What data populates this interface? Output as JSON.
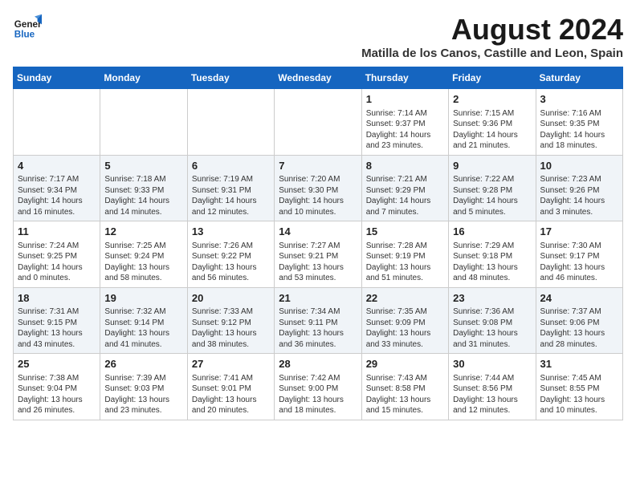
{
  "header": {
    "logo_line1": "General",
    "logo_line2": "Blue",
    "main_title": "August 2024",
    "subtitle": "Matilla de los Canos, Castille and Leon, Spain"
  },
  "calendar": {
    "days_of_week": [
      "Sunday",
      "Monday",
      "Tuesday",
      "Wednesday",
      "Thursday",
      "Friday",
      "Saturday"
    ],
    "weeks": [
      [
        {
          "day": "",
          "info": ""
        },
        {
          "day": "",
          "info": ""
        },
        {
          "day": "",
          "info": ""
        },
        {
          "day": "",
          "info": ""
        },
        {
          "day": "1",
          "info": "Sunrise: 7:14 AM\nSunset: 9:37 PM\nDaylight: 14 hours\nand 23 minutes."
        },
        {
          "day": "2",
          "info": "Sunrise: 7:15 AM\nSunset: 9:36 PM\nDaylight: 14 hours\nand 21 minutes."
        },
        {
          "day": "3",
          "info": "Sunrise: 7:16 AM\nSunset: 9:35 PM\nDaylight: 14 hours\nand 18 minutes."
        }
      ],
      [
        {
          "day": "4",
          "info": "Sunrise: 7:17 AM\nSunset: 9:34 PM\nDaylight: 14 hours\nand 16 minutes."
        },
        {
          "day": "5",
          "info": "Sunrise: 7:18 AM\nSunset: 9:33 PM\nDaylight: 14 hours\nand 14 minutes."
        },
        {
          "day": "6",
          "info": "Sunrise: 7:19 AM\nSunset: 9:31 PM\nDaylight: 14 hours\nand 12 minutes."
        },
        {
          "day": "7",
          "info": "Sunrise: 7:20 AM\nSunset: 9:30 PM\nDaylight: 14 hours\nand 10 minutes."
        },
        {
          "day": "8",
          "info": "Sunrise: 7:21 AM\nSunset: 9:29 PM\nDaylight: 14 hours\nand 7 minutes."
        },
        {
          "day": "9",
          "info": "Sunrise: 7:22 AM\nSunset: 9:28 PM\nDaylight: 14 hours\nand 5 minutes."
        },
        {
          "day": "10",
          "info": "Sunrise: 7:23 AM\nSunset: 9:26 PM\nDaylight: 14 hours\nand 3 minutes."
        }
      ],
      [
        {
          "day": "11",
          "info": "Sunrise: 7:24 AM\nSunset: 9:25 PM\nDaylight: 14 hours\nand 0 minutes."
        },
        {
          "day": "12",
          "info": "Sunrise: 7:25 AM\nSunset: 9:24 PM\nDaylight: 13 hours\nand 58 minutes."
        },
        {
          "day": "13",
          "info": "Sunrise: 7:26 AM\nSunset: 9:22 PM\nDaylight: 13 hours\nand 56 minutes."
        },
        {
          "day": "14",
          "info": "Sunrise: 7:27 AM\nSunset: 9:21 PM\nDaylight: 13 hours\nand 53 minutes."
        },
        {
          "day": "15",
          "info": "Sunrise: 7:28 AM\nSunset: 9:19 PM\nDaylight: 13 hours\nand 51 minutes."
        },
        {
          "day": "16",
          "info": "Sunrise: 7:29 AM\nSunset: 9:18 PM\nDaylight: 13 hours\nand 48 minutes."
        },
        {
          "day": "17",
          "info": "Sunrise: 7:30 AM\nSunset: 9:17 PM\nDaylight: 13 hours\nand 46 minutes."
        }
      ],
      [
        {
          "day": "18",
          "info": "Sunrise: 7:31 AM\nSunset: 9:15 PM\nDaylight: 13 hours\nand 43 minutes."
        },
        {
          "day": "19",
          "info": "Sunrise: 7:32 AM\nSunset: 9:14 PM\nDaylight: 13 hours\nand 41 minutes."
        },
        {
          "day": "20",
          "info": "Sunrise: 7:33 AM\nSunset: 9:12 PM\nDaylight: 13 hours\nand 38 minutes."
        },
        {
          "day": "21",
          "info": "Sunrise: 7:34 AM\nSunset: 9:11 PM\nDaylight: 13 hours\nand 36 minutes."
        },
        {
          "day": "22",
          "info": "Sunrise: 7:35 AM\nSunset: 9:09 PM\nDaylight: 13 hours\nand 33 minutes."
        },
        {
          "day": "23",
          "info": "Sunrise: 7:36 AM\nSunset: 9:08 PM\nDaylight: 13 hours\nand 31 minutes."
        },
        {
          "day": "24",
          "info": "Sunrise: 7:37 AM\nSunset: 9:06 PM\nDaylight: 13 hours\nand 28 minutes."
        }
      ],
      [
        {
          "day": "25",
          "info": "Sunrise: 7:38 AM\nSunset: 9:04 PM\nDaylight: 13 hours\nand 26 minutes."
        },
        {
          "day": "26",
          "info": "Sunrise: 7:39 AM\nSunset: 9:03 PM\nDaylight: 13 hours\nand 23 minutes."
        },
        {
          "day": "27",
          "info": "Sunrise: 7:41 AM\nSunset: 9:01 PM\nDaylight: 13 hours\nand 20 minutes."
        },
        {
          "day": "28",
          "info": "Sunrise: 7:42 AM\nSunset: 9:00 PM\nDaylight: 13 hours\nand 18 minutes."
        },
        {
          "day": "29",
          "info": "Sunrise: 7:43 AM\nSunset: 8:58 PM\nDaylight: 13 hours\nand 15 minutes."
        },
        {
          "day": "30",
          "info": "Sunrise: 7:44 AM\nSunset: 8:56 PM\nDaylight: 13 hours\nand 12 minutes."
        },
        {
          "day": "31",
          "info": "Sunrise: 7:45 AM\nSunset: 8:55 PM\nDaylight: 13 hours\nand 10 minutes."
        }
      ]
    ]
  }
}
